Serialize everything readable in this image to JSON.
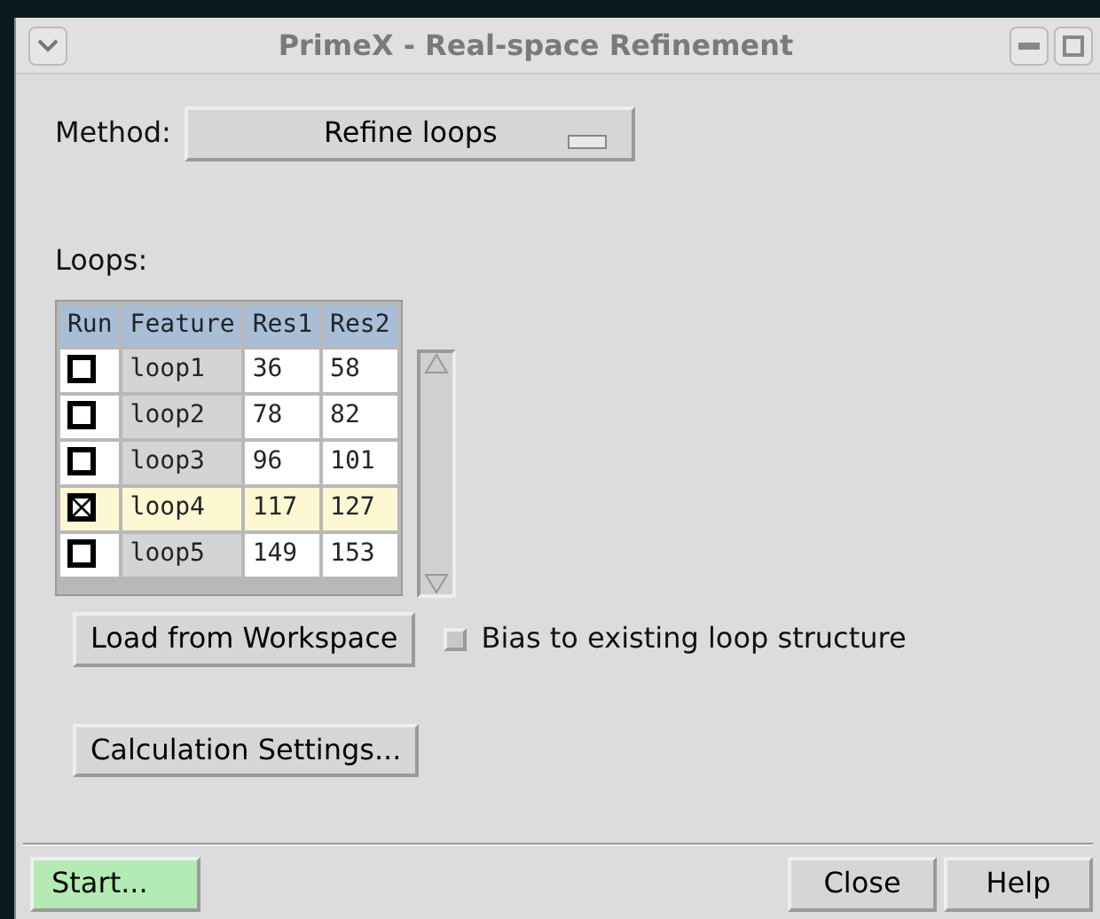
{
  "window": {
    "title": "PrimeX - Real-space Refinement"
  },
  "method": {
    "label": "Method:",
    "value": "Refine loops"
  },
  "loops": {
    "label": "Loops:",
    "columns": [
      "Run",
      "Feature",
      "Res1",
      "Res2"
    ],
    "rows": [
      {
        "checked": false,
        "selected": false,
        "feature": "loop1",
        "res1": "36",
        "res2": "58"
      },
      {
        "checked": false,
        "selected": false,
        "feature": "loop2",
        "res1": "78",
        "res2": "82"
      },
      {
        "checked": false,
        "selected": false,
        "feature": "loop3",
        "res1": "96",
        "res2": "101"
      },
      {
        "checked": true,
        "selected": true,
        "feature": "loop4",
        "res1": "117",
        "res2": "127"
      },
      {
        "checked": false,
        "selected": false,
        "feature": "loop5",
        "res1": "149",
        "res2": "153"
      }
    ]
  },
  "load_button": "Load from Workspace",
  "bias": {
    "label": "Bias to existing loop structure",
    "checked": false
  },
  "settings_button": "Calculation Settings...",
  "footer_buttons": [
    {
      "label": "Start...",
      "kind": "primary"
    },
    {
      "label": "Close",
      "kind": "normal"
    },
    {
      "label": "Help",
      "kind": "normal"
    }
  ]
}
